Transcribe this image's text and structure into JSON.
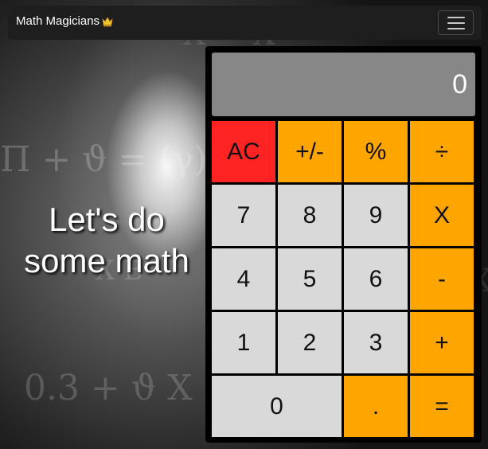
{
  "navbar": {
    "brand": "Math Magicians",
    "brand_icon": "crown-icon",
    "menu_icon": "hamburger-menu-icon"
  },
  "hero": {
    "line1": "Let's do",
    "line2": "some math"
  },
  "background": {
    "formula_fragments": [
      "Π + ϑ = (γ)",
      "(γ)",
      "0.3 + ϑ X",
      "X = X",
      "X  B",
      "X"
    ]
  },
  "calculator": {
    "display_value": "0",
    "keys": [
      {
        "label": "AC",
        "type": "clear",
        "name": "all-clear-button"
      },
      {
        "label": "+/-",
        "type": "op",
        "name": "negate-button"
      },
      {
        "label": "%",
        "type": "op",
        "name": "percent-button"
      },
      {
        "label": "÷",
        "type": "op",
        "name": "divide-button"
      },
      {
        "label": "7",
        "type": "num",
        "name": "digit-7-button"
      },
      {
        "label": "8",
        "type": "num",
        "name": "digit-8-button"
      },
      {
        "label": "9",
        "type": "num",
        "name": "digit-9-button"
      },
      {
        "label": "X",
        "type": "op",
        "name": "multiply-button"
      },
      {
        "label": "4",
        "type": "num",
        "name": "digit-4-button"
      },
      {
        "label": "5",
        "type": "num",
        "name": "digit-5-button"
      },
      {
        "label": "6",
        "type": "num",
        "name": "digit-6-button"
      },
      {
        "label": "-",
        "type": "op",
        "name": "subtract-button"
      },
      {
        "label": "1",
        "type": "num",
        "name": "digit-1-button"
      },
      {
        "label": "2",
        "type": "num",
        "name": "digit-2-button"
      },
      {
        "label": "3",
        "type": "num",
        "name": "digit-3-button"
      },
      {
        "label": "+",
        "type": "op",
        "name": "add-button"
      },
      {
        "label": "0",
        "type": "zero",
        "name": "digit-0-button"
      },
      {
        "label": ".",
        "type": "op",
        "name": "decimal-button"
      },
      {
        "label": "=",
        "type": "op",
        "name": "equals-button"
      }
    ]
  },
  "colors": {
    "operator": "#ffa500",
    "clear": "#ff2424",
    "number": "#d9d9d9",
    "display": "#878787"
  }
}
